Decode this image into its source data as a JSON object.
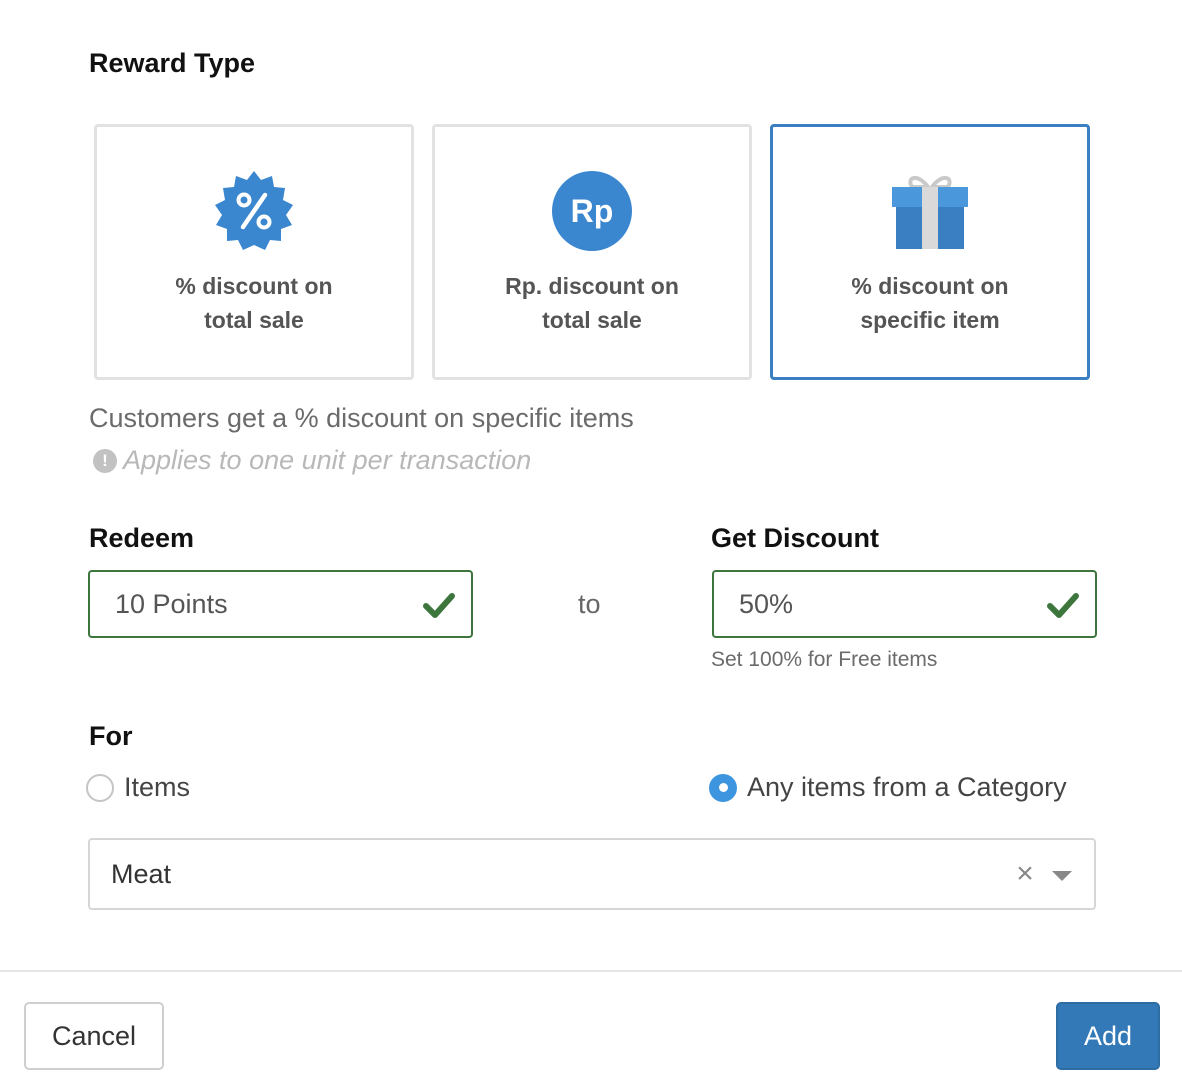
{
  "reward_type": {
    "title": "Reward Type",
    "options": [
      {
        "line1": "% discount on",
        "line2": "total sale",
        "icon": "percent-badge-icon",
        "selected": false
      },
      {
        "line1": "Rp. discount on",
        "line2": "total sale",
        "icon": "rp-coin-icon",
        "icon_text": "Rp",
        "selected": false
      },
      {
        "line1": "% discount on",
        "line2": "specific item",
        "icon": "gift-icon",
        "selected": true
      }
    ]
  },
  "description": "Customers get a % discount on specific items",
  "note": {
    "icon": "!",
    "text": "Applies to one unit per transaction"
  },
  "redeem": {
    "label": "Redeem",
    "value": "10 Points"
  },
  "to_text": "to",
  "discount": {
    "label": "Get Discount",
    "value": "50%",
    "help": "Set 100% for Free items"
  },
  "for": {
    "label": "For",
    "options": [
      {
        "label": "Items",
        "checked": false
      },
      {
        "label": "Any items from a Category",
        "checked": true
      }
    ]
  },
  "category_select": {
    "value": "Meat",
    "clear": "×"
  },
  "buttons": {
    "cancel": "Cancel",
    "add": "Add"
  },
  "colors": {
    "accent": "#3a7fc1",
    "valid_border": "#3c763d",
    "primary_button": "#3379b7",
    "radio_checked": "#3d95e0"
  }
}
